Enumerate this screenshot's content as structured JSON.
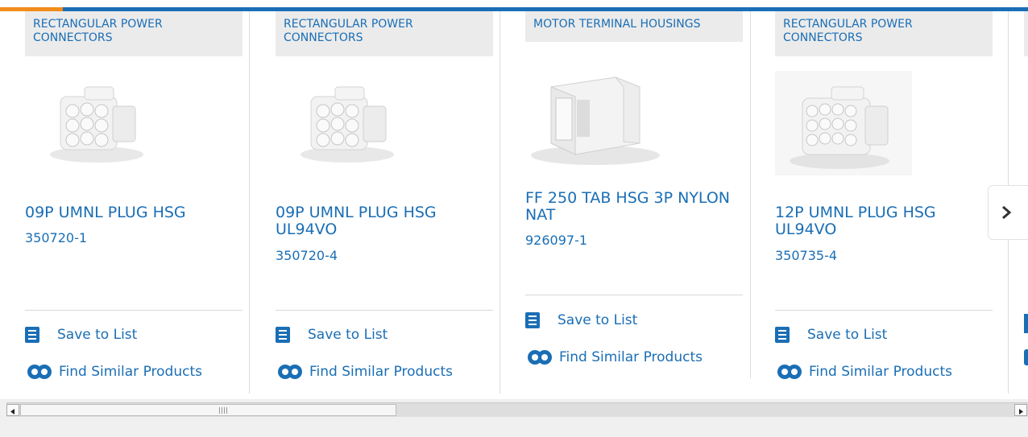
{
  "cards": [
    {
      "category": "RECTANGULAR POWER CONNECTORS",
      "title": "09P UMNL PLUG HSG",
      "part": "350720-1",
      "image": "9-pin-connector-image"
    },
    {
      "category": "RECTANGULAR POWER CONNECTORS",
      "title": "09P UMNL PLUG HSG UL94VO",
      "part": "350720-4",
      "image": "9-pin-connector-image"
    },
    {
      "category": "MOTOR TERMINAL HOUSINGS",
      "title": "FF 250 TAB HSG 3P NYLON NAT",
      "part": "926097-1",
      "image": "tab-housing-image"
    },
    {
      "category": "RECTANGULAR POWER CONNECTORS",
      "title": "12P UMNL PLUG HSG UL94VO",
      "part": "350735-4",
      "image": "12-pin-connector-image"
    }
  ],
  "actions": {
    "save": "Save to List",
    "similar": "Find Similar Products"
  },
  "icons": {
    "save": "checklist-icon",
    "similar": "find-similar-icon",
    "next": "chevron-right-icon"
  },
  "colors": {
    "link": "#1a6eb5",
    "accent": "#f28c1a"
  }
}
